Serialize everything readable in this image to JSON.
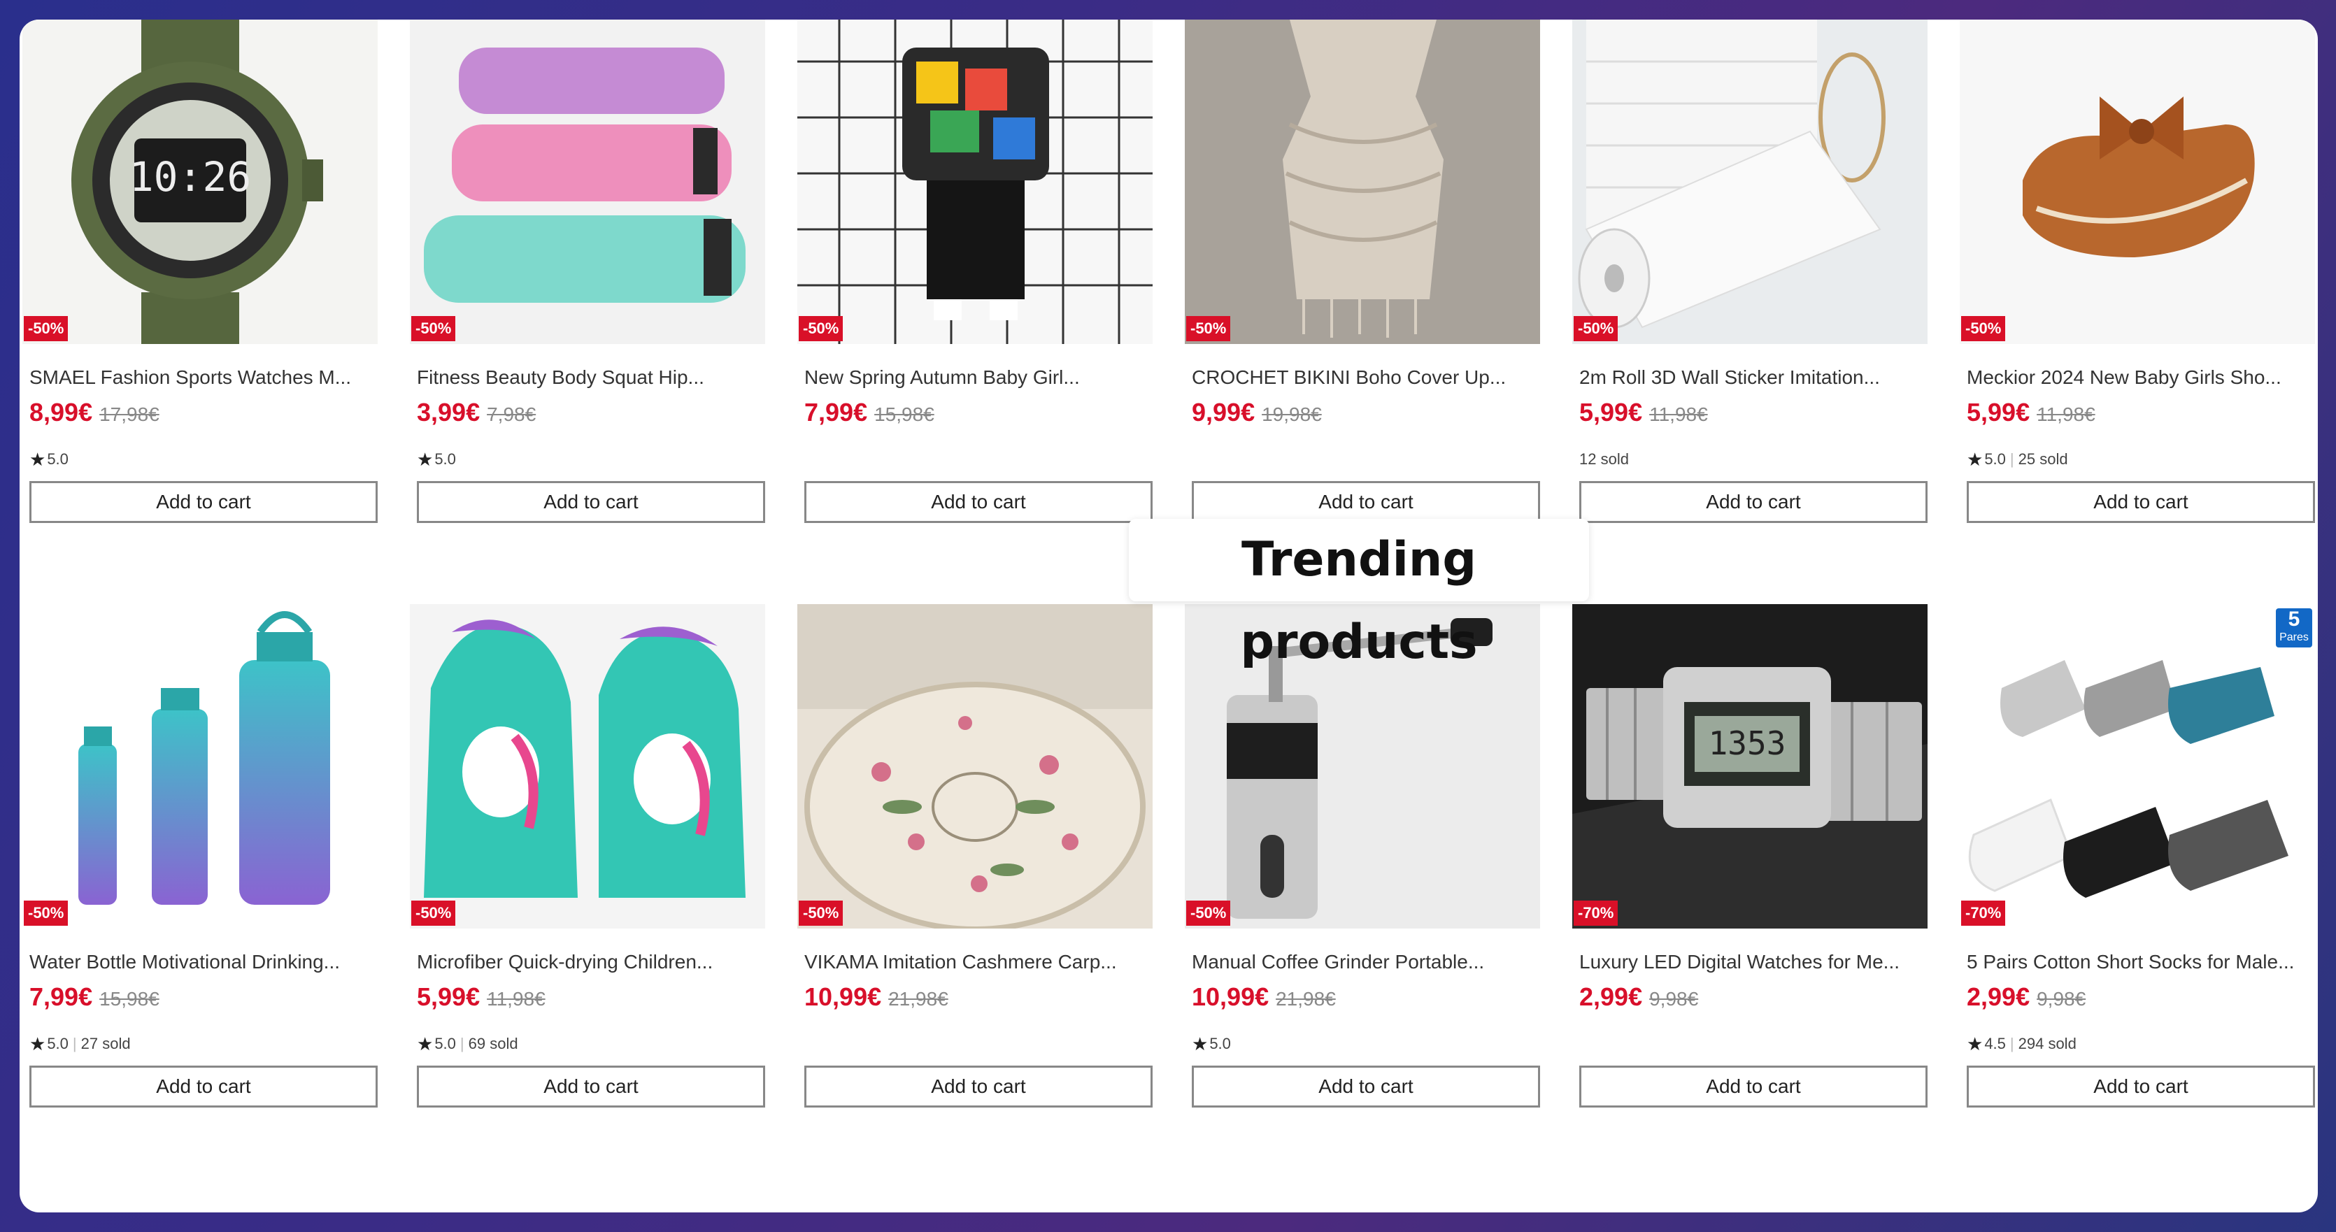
{
  "section_title": "Trending products",
  "add_to_cart_label": "Add to cart",
  "star_glyph": "★",
  "colors": {
    "discount": "#d91028",
    "price": "#d80f2a",
    "badge": "#1268c6"
  },
  "row1": [
    {
      "title": "SMAEL Fashion Sports Watches M...",
      "price": "8,99€",
      "old_price": "17,98€",
      "discount": "-50%",
      "rating": "5.0",
      "sold": "",
      "image_icon": "sports-watch-icon"
    },
    {
      "title": "Fitness Beauty Body Squat Hip...",
      "price": "3,99€",
      "old_price": "7,98€",
      "discount": "-50%",
      "rating": "5.0",
      "sold": "",
      "image_icon": "resistance-bands-icon"
    },
    {
      "title": "New Spring Autumn Baby Girl...",
      "price": "7,99€",
      "old_price": "15,98€",
      "discount": "-50%",
      "rating": "",
      "sold": "",
      "image_icon": "baby-outfit-icon"
    },
    {
      "title": "CROCHET BIKINI Boho Cover Up...",
      "price": "9,99€",
      "old_price": "19,98€",
      "discount": "-50%",
      "rating": "",
      "sold": "",
      "image_icon": "crochet-top-icon"
    },
    {
      "title": "2m Roll 3D Wall Sticker Imitation...",
      "price": "5,99€",
      "old_price": "11,98€",
      "discount": "-50%",
      "rating": "",
      "sold": "12 sold",
      "image_icon": "wall-sticker-roll-icon"
    },
    {
      "title": "Meckior 2024 New Baby Girls Sho...",
      "price": "5,99€",
      "old_price": "11,98€",
      "discount": "-50%",
      "rating": "5.0",
      "sold": "25 sold",
      "image_icon": "baby-shoe-icon"
    }
  ],
  "row2": [
    {
      "title": "Water Bottle Motivational Drinking...",
      "price": "7,99€",
      "old_price": "15,98€",
      "discount": "-50%",
      "rating": "5.0",
      "sold": "27 sold",
      "image_icon": "water-bottles-icon"
    },
    {
      "title": "Microfiber Quick-drying Children...",
      "price": "5,99€",
      "old_price": "11,98€",
      "discount": "-50%",
      "rating": "5.0",
      "sold": "69 sold",
      "image_icon": "unicorn-towel-icon"
    },
    {
      "title": "VIKAMA Imitation Cashmere Carp...",
      "price": "10,99€",
      "old_price": "21,98€",
      "discount": "-50%",
      "rating": "",
      "sold": "",
      "image_icon": "round-carpet-icon"
    },
    {
      "title": "Manual Coffee Grinder Portable...",
      "price": "10,99€",
      "old_price": "21,98€",
      "discount": "-50%",
      "rating": "5.0",
      "sold": "",
      "image_icon": "coffee-grinder-icon"
    },
    {
      "title": "Luxury LED Digital Watches for Me...",
      "price": "2,99€",
      "old_price": "9,98€",
      "discount": "-70%",
      "rating": "",
      "sold": "",
      "image_icon": "digital-watch-icon"
    },
    {
      "title": "5 Pairs Cotton Short Socks for Male...",
      "price": "2,99€",
      "old_price": "9,98€",
      "discount": "-70%",
      "rating": "4.5",
      "sold": "294 sold",
      "image_icon": "socks-icon",
      "pack_badge": {
        "number": "5",
        "text": "Pares"
      }
    }
  ]
}
